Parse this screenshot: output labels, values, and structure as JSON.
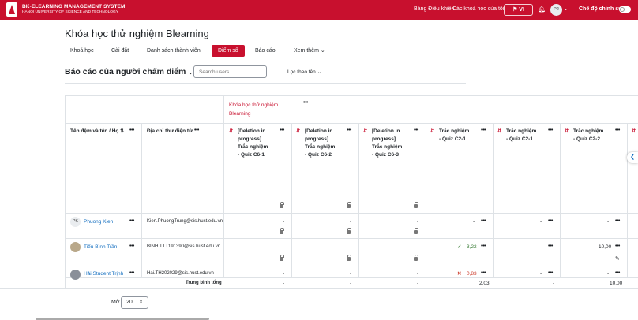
{
  "header": {
    "brand_line1": "BK-ELEARNING MANAGEMENT SYSTEM",
    "brand_line2": "HANOI UNIVERSITY OF SCIENCE AND TECHNOLOGY",
    "nav": [
      "Bảng Điều khiển",
      "Các khoá học của tôi"
    ],
    "lang": "VI",
    "avatar": "P2",
    "edit_mode": "Chế độ chỉnh sửa"
  },
  "page": {
    "title": "Khóa học thử nghiệm Blearning",
    "tabs": [
      "Khoá học",
      "Cài đặt",
      "Danh sách thành viên",
      "Điểm số",
      "Báo cáo",
      "Xem thêm"
    ],
    "active_tab": "Điểm số"
  },
  "report": {
    "title": "Báo cáo của người chấm điểm",
    "search_placeholder": "Search users",
    "filter": "Lọc theo tên"
  },
  "grid": {
    "course": [
      "Khóa học thử nghiệm",
      "Blearning"
    ],
    "col_name": "Tên đệm và tên / Họ",
    "col_email": "Địa chỉ thư điện tử",
    "items": [
      [
        "[Deletion in",
        "progress]",
        "Trắc nghiệm",
        "- Quiz C6-1"
      ],
      [
        "[Deletion in",
        "progress]",
        "Trắc nghiệm",
        "- Quiz C6-2"
      ],
      [
        "[Deletion in",
        "progress]",
        "Trắc nghiệm",
        "- Quiz C6-3"
      ],
      [
        "Trắc nghiệm",
        "- Quiz C2-1"
      ],
      [
        "Trắc nghiệm",
        "- Quiz C2-1"
      ],
      [
        "Trắc nghiệm",
        "- Quiz C2-2"
      ]
    ],
    "rows": [
      {
        "initials": "PK",
        "name": "Phuong Kien",
        "email": "Kien.PhuongTrung@sis.hust.edu.vn",
        "grades": [
          "-",
          "-",
          "-",
          "-",
          "-",
          "-"
        ]
      },
      {
        "initials": "",
        "name": "Tiểu Bình Trần",
        "email": "BINH.TTT191390@sis.hust.edu.vn",
        "grades": [
          "-",
          "-",
          "-",
          "3,22",
          "-",
          "10,00"
        ]
      },
      {
        "initials": "",
        "name": "Hải Student Trịnh",
        "email": "Hai.TH202029@sis.hust.edu.vn",
        "grades": [
          "-",
          "-",
          "-",
          "0,83",
          "-",
          "-"
        ]
      }
    ],
    "avg_label": "Trung bình tổng",
    "avg": [
      "-",
      "-",
      "-",
      "2,03",
      "-",
      "10,00"
    ]
  },
  "footer": {
    "per_page_label": "Mở",
    "per_page": "20"
  }
}
